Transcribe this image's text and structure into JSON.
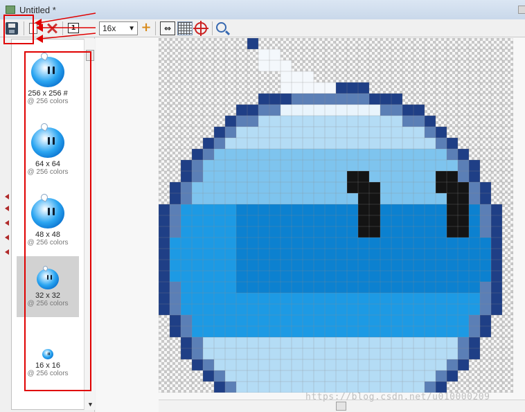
{
  "window": {
    "title": "Untitled *"
  },
  "toolbar": {
    "zoom_value": "16x",
    "frame_label": "1",
    "add_label": "+",
    "fit_label": "⇔"
  },
  "icon_list": [
    {
      "size": "256 x 256 #",
      "colors": "@ 256 colors",
      "selected": false
    },
    {
      "size": "64 x 64",
      "colors": "@ 256 colors",
      "selected": false
    },
    {
      "size": "48 x 48",
      "colors": "@ 256 colors",
      "selected": false
    },
    {
      "size": "32 x 32",
      "colors": "@ 256 colors",
      "selected": true
    },
    {
      "size": "16 x 16",
      "colors": "@ 256 colors",
      "selected": false
    }
  ],
  "watermark": "https://blog.csdn.net/u010000209",
  "colors": {
    "annotation": "#e00000",
    "checker_light": "#ffffff",
    "checker_dark": "#c8c8c8",
    "outline_dark": "#1f3f86",
    "outline_mid": "#5b7fb6",
    "body_pale": "#e9f4fc",
    "body_light": "#b4dcf5",
    "body_mid": "#7ec4ee",
    "body_main": "#1d9ae4",
    "body_deep": "#0c81d0",
    "eye": "#141414",
    "eye_edge": "#2a3e4c",
    "spout": "#f4f8fc"
  }
}
